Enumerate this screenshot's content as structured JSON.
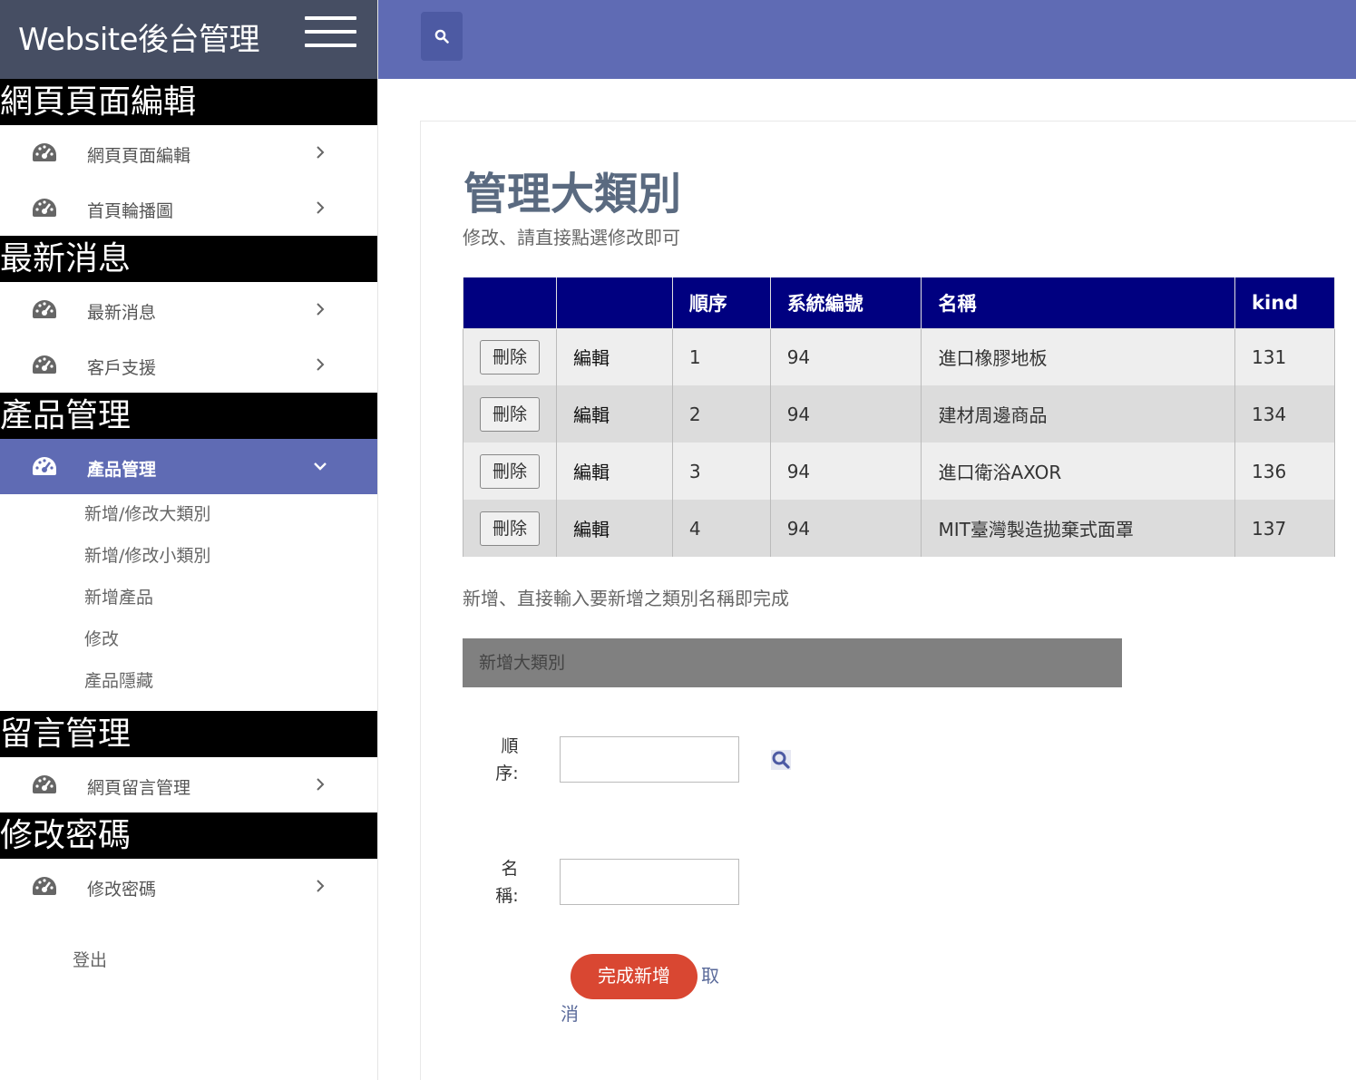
{
  "app": {
    "title": "Website後台管理"
  },
  "sidebar": {
    "sections": [
      {
        "header": "網頁頁面編輯",
        "items": [
          {
            "label": "網頁頁面編輯"
          },
          {
            "label": "首頁輪播圖"
          }
        ]
      },
      {
        "header": "最新消息",
        "items": [
          {
            "label": "最新消息"
          },
          {
            "label": "客戶支援"
          }
        ]
      },
      {
        "header": "產品管理",
        "items": [
          {
            "label": "產品管理"
          }
        ],
        "submenu": [
          "新增/修改大類別",
          "新增/修改小類別",
          "新增產品",
          "修改",
          "產品隱藏"
        ]
      },
      {
        "header": "留言管理",
        "items": [
          {
            "label": "網頁留言管理"
          }
        ]
      },
      {
        "header": "修改密碼",
        "items": [
          {
            "label": "修改密碼"
          }
        ]
      }
    ],
    "logout": "登出"
  },
  "main": {
    "title": "管理大類別",
    "description": "修改、請直接點選修改即可",
    "table": {
      "headers": [
        "",
        "",
        "順序",
        "系統編號",
        "名稱",
        "kind"
      ],
      "delete_label": "刪除",
      "edit_label": "編輯",
      "rows": [
        {
          "order": "1",
          "sys_id": "94",
          "name": "進口橡膠地板",
          "kind": "131"
        },
        {
          "order": "2",
          "sys_id": "94",
          "name": "建材周邊商品",
          "kind": "134"
        },
        {
          "order": "3",
          "sys_id": "94",
          "name": "進口衛浴AXOR",
          "kind": "136"
        },
        {
          "order": "4",
          "sys_id": "94",
          "name": "MIT臺灣製造拋棄式面罩",
          "kind": "137"
        }
      ]
    },
    "add_description": "新增、直接輸入要新增之類別名稱即完成",
    "add_panel_title": "新增大類別",
    "form": {
      "order_label_1": "順",
      "order_label_2": "序:",
      "order_value": "",
      "name_label_1": "名",
      "name_label_2": "稱:",
      "name_value": "",
      "submit_label": "完成新增",
      "cancel_label_1": "取",
      "cancel_label_2": "消"
    }
  }
}
